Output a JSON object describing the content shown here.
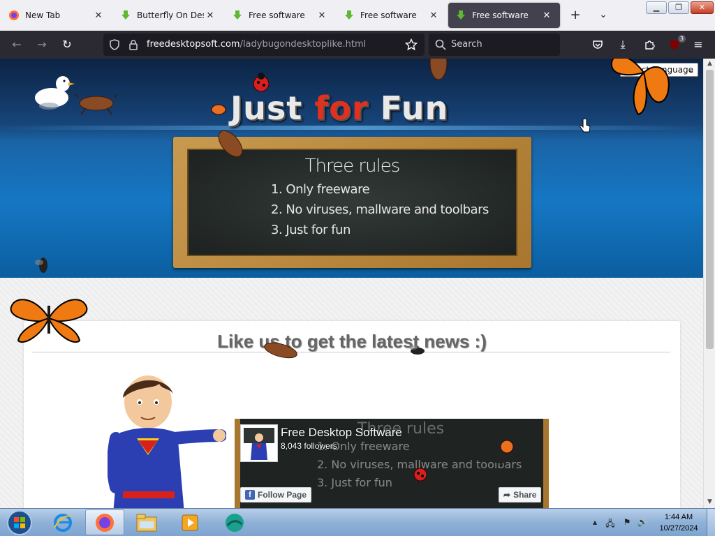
{
  "browser": {
    "tabs": [
      {
        "title": "New Tab",
        "icon": "firefox-icon",
        "active": false
      },
      {
        "title": "Butterfly On Deskto",
        "icon": "download-icon",
        "active": false
      },
      {
        "title": "Free software",
        "icon": "download-icon",
        "active": false
      },
      {
        "title": "Free software",
        "icon": "download-icon",
        "active": false
      },
      {
        "title": "Free software",
        "icon": "download-icon",
        "active": true
      }
    ],
    "url_host": "freedesktopsoft.com",
    "url_path": "/ladybugondesktoplike.html",
    "search_placeholder": "Search",
    "extension_badge": "3"
  },
  "page": {
    "language_select": "Select Language",
    "logo": {
      "word1": "Just ",
      "word2": "for",
      "word3": " Fun"
    },
    "board": {
      "title": "Three rules",
      "rules": [
        "1. Only freeware",
        "2. No viruses, mallware and toolbars",
        "3. Just for fun"
      ]
    },
    "like_heading": "Like us to get the latest news :)",
    "facebook": {
      "page_name": "Free Desktop Software",
      "followers": "8,043 followers",
      "follow_label": "Follow Page",
      "share_label": "Share",
      "bg_title": "Three rules",
      "bg_rules": [
        "1. Only freeware",
        "2. No viruses, mallware and toolbars",
        "3. Just for fun"
      ]
    }
  },
  "taskbar": {
    "time": "1:44 AM",
    "date": "10/27/2024"
  },
  "colors": {
    "accent_red": "#e0301e",
    "browser_dark": "#2b2a33",
    "butterfly_orange": "#f07a12"
  }
}
